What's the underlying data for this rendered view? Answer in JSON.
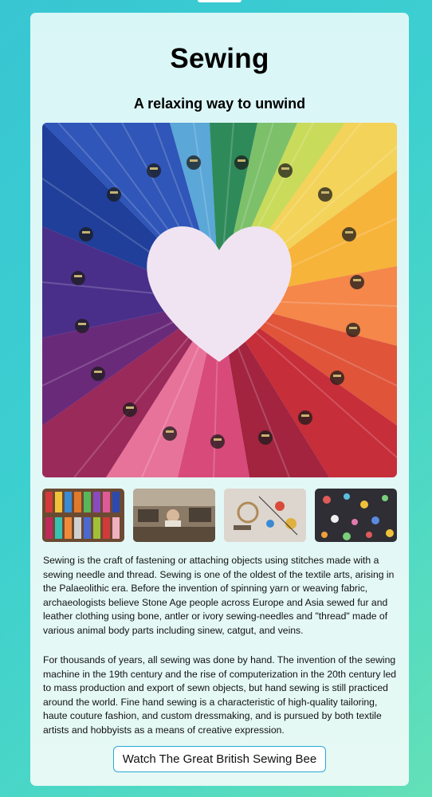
{
  "page": {
    "title": "Sewing",
    "subtitle": "A relaxing way to unwind"
  },
  "gallery": {
    "hero_image": "heart-of-embroidery-threads",
    "thumbnails": [
      {
        "image": "spools-of-thread"
      },
      {
        "image": "sewing-workshop"
      },
      {
        "image": "sewing-notions"
      },
      {
        "image": "embroidered-fabric"
      }
    ]
  },
  "content": {
    "paragraph_1": "Sewing is the craft of fastening or attaching objects using stitches made with a sewing needle and thread. Sewing is one of the oldest of the textile arts, arising in the Palaeolithic era. Before the invention of spinning yarn or weaving fabric, archaeologists believe Stone Age people across Europe and Asia sewed fur and leather clothing using bone, antler or ivory sewing-needles and \"thread\" made of various animal body parts including sinew, catgut, and veins.",
    "paragraph_2": "For thousands of years, all sewing was done by hand. The invention of the sewing machine in the 19th century and the rise of computerization in the 20th century led to mass production and export of sewn objects, but hand sewing is still practiced around the world. Fine hand sewing is a characteristic of high-quality tailoring, haute couture fashion, and custom dressmaking, and is pursued by both textile artists and hobbyists as a means of creative expression."
  },
  "cta": {
    "label": "Watch The Great British Sewing Bee"
  },
  "colors": {
    "background_start": "#38c6d3",
    "background_end": "#63e0b7",
    "card": "#dff7f5",
    "button_border": "#2aa9d8"
  }
}
